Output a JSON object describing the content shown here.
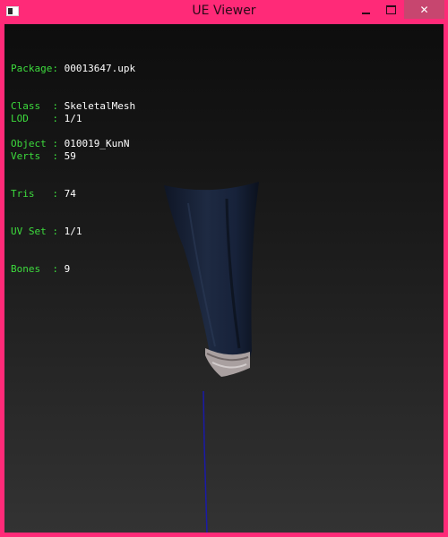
{
  "window": {
    "title": "UE Viewer",
    "accent_color": "#ff2a78",
    "close_button_color": "#c7466f",
    "controls": {
      "minimize_icon": "minimize-icon",
      "maximize_icon": "maximize-icon",
      "close_icon": "close-icon",
      "close_glyph": "✕"
    }
  },
  "info_block_1": [
    {
      "label": "Package: ",
      "value": "00013647.upk"
    },
    {
      "label": "Class  : ",
      "value": "SkeletalMesh"
    },
    {
      "label": "Object : ",
      "value": "010019_KunN"
    }
  ],
  "info_block_2": [
    {
      "label": "LOD    : ",
      "value": "1/1"
    },
    {
      "label": "Verts  : ",
      "value": "59"
    },
    {
      "label": "Tris   : ",
      "value": "74"
    },
    {
      "label": "UV Set : ",
      "value": "1/1"
    },
    {
      "label": "Bones  : ",
      "value": "9"
    }
  ],
  "colors": {
    "label_green": "#3ddc3d",
    "value_white": "#ffffff",
    "mesh_dark": "#1a2438",
    "mesh_trim": "#b0a8a8",
    "axis_blue": "#1a1aa8"
  }
}
